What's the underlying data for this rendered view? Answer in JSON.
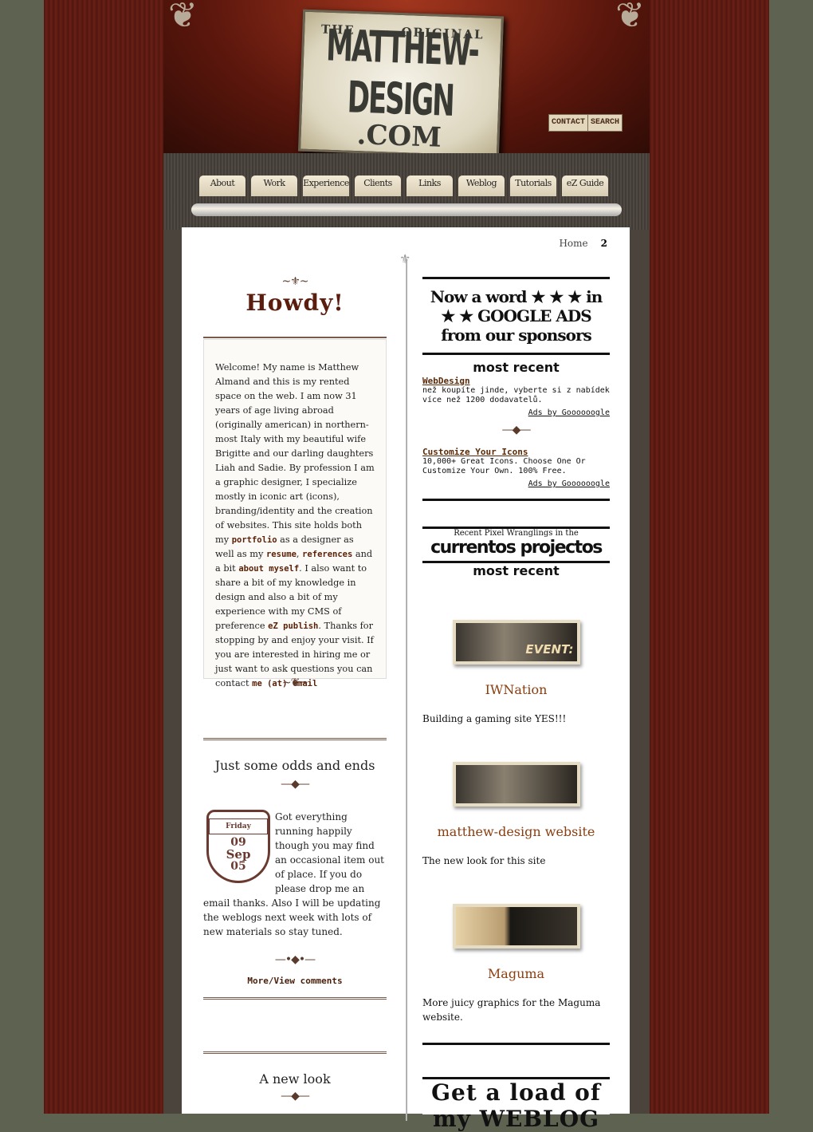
{
  "header": {
    "logo_text": "THE ORIGINAL MATTHEW-DESIGN .COM",
    "contact_label": "CONTACT",
    "search_label": "SEARCH"
  },
  "nav": {
    "tabs": [
      "About",
      "Work",
      "Experience",
      "Clients",
      "Links",
      "Weblog",
      "Tutorials",
      "eZ Guide"
    ]
  },
  "breadcrumb": {
    "home": "Home",
    "page": "2"
  },
  "intro": {
    "heading": "Howdy!",
    "p1": "Welcome! My name is Matthew Almand and this is my rented space on the web. I am now 31 years of age living abroad (originally american) in northern-most Italy with my beautiful wife Brigitte and our darling daughters Liah and Sadie. By profession I am a graphic designer, I specialize mostly in iconic art (icons), branding/identity and the creation of websites. This site holds both my ",
    "link_portfolio": "portfolio",
    "t2": " as a designer as well as my ",
    "link_resume": "resume",
    "t3": ", ",
    "link_references": "references",
    "t4": " and a bit ",
    "link_about": "about myself",
    "t5": ". I also want to share a bit of my knowledge in design and also a bit of my experience with my CMS of preference ",
    "link_ez": "eZ publish",
    "t6": ". Thanks for stopping by and enjoy your visit. If you are interested in hiring me or just want to ask questions you can contact ",
    "link_mail": "me (at) Gmail"
  },
  "posts": [
    {
      "title": "Just some odds and ends",
      "date_day": "Friday",
      "date_d": "09",
      "date_m": "Sep",
      "date_y": "05",
      "body": "Got everything running happily though you may find an occasional item out of place. If you do please drop me an email thanks. Also I will be updating the weblogs next week with lots of new materials so stay tuned.",
      "more": "More/View comments"
    },
    {
      "title": "A new look"
    }
  ],
  "ads": {
    "banner": "Now a word ★ ★ ★ in ★ ★ GOOGLE ADS from our sponsors",
    "banner_sub": "most recent",
    "items": [
      {
        "title": "WebDesign",
        "text": "než koupíte jinde, vyberte si z nabídek více než 1200 dodavatelů.",
        "by": "Ads by Goooooogle"
      },
      {
        "title": "Customize Your Icons",
        "text": "10,000+ Great Icons. Choose One Or Customize Your Own. 100% Free.",
        "by": "Ads by Goooooogle"
      }
    ]
  },
  "projects": {
    "banner_top": "Recent Pixel Wranglings in the",
    "banner_main": "currentos projectos",
    "banner_sub": "most recent",
    "items": [
      {
        "thumb_label": "EVENT:",
        "title": "IWNation",
        "desc": "Building a gaming site YES!!!"
      },
      {
        "thumb_label": "",
        "title": "matthew-design website",
        "desc": "The new look for this site"
      },
      {
        "thumb_label": "",
        "title": "Maguma",
        "desc": "More juicy graphics for the Maguma website."
      }
    ]
  },
  "weblog": {
    "banner": "Get a load of my WEBLOG"
  }
}
